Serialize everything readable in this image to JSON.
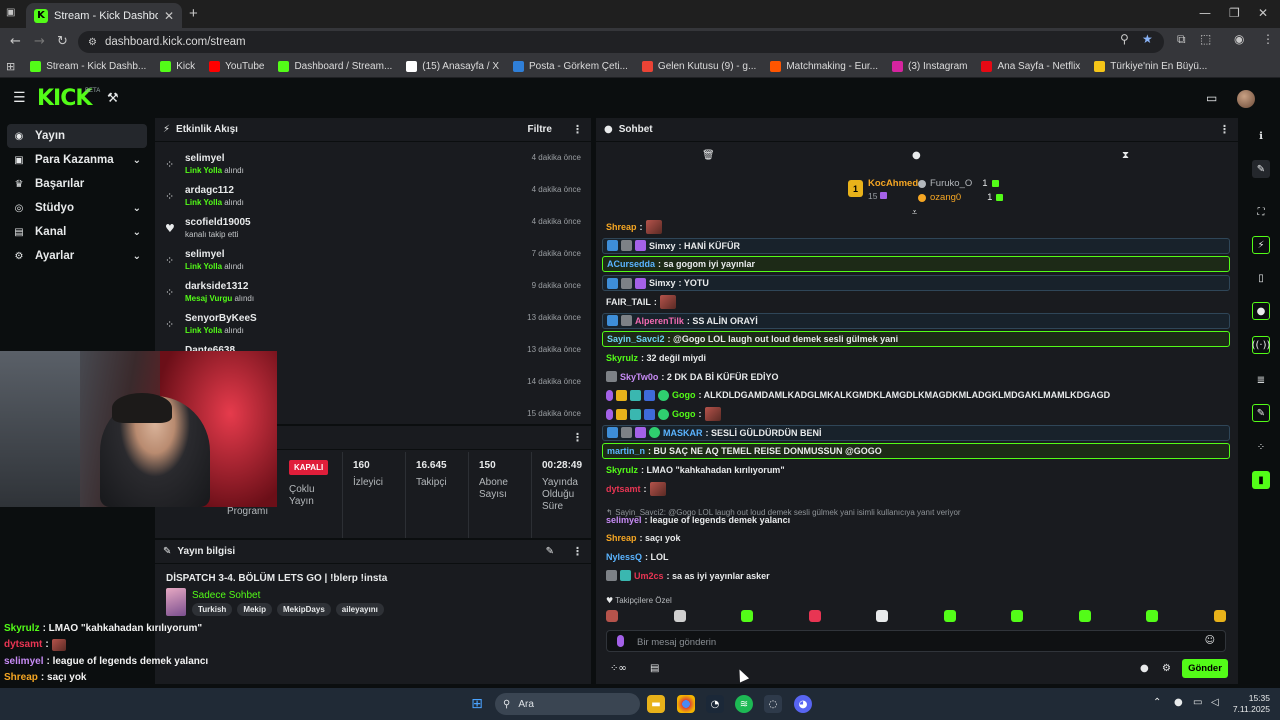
{
  "browser": {
    "tab_title": "Stream - Kick Dashboard",
    "url": "dashboard.kick.com/stream",
    "bookmarks": [
      {
        "label": "Stream - Kick Dashb...",
        "icon": "kick-icon",
        "color": "#53fc18"
      },
      {
        "label": "Kick",
        "icon": "kick-icon",
        "color": "#53fc18"
      },
      {
        "label": "YouTube",
        "icon": "youtube-icon",
        "color": "#ff0000"
      },
      {
        "label": "Dashboard / Stream...",
        "icon": "kick-icon",
        "color": "#53fc18"
      },
      {
        "label": "(15) Anasayfa / X",
        "icon": "x-icon",
        "color": "#ffffff"
      },
      {
        "label": "Posta - Görkem Çeti...",
        "icon": "outlook-icon",
        "color": "#2f7fd8"
      },
      {
        "label": "Gelen Kutusu (9) - g...",
        "icon": "gmail-icon",
        "color": "#ea4335"
      },
      {
        "label": "Matchmaking - Eur...",
        "icon": "faceit-icon",
        "color": "#ff5500"
      },
      {
        "label": "(3) Instagram",
        "icon": "instagram-icon",
        "color": "#d6249f"
      },
      {
        "label": "Ana Sayfa - Netflix",
        "icon": "netflix-icon",
        "color": "#e50914"
      },
      {
        "label": "Türkiye'nin En Büyü...",
        "icon": "eksi-icon",
        "color": "#f5c518"
      }
    ]
  },
  "kick": {
    "logo": "KICK",
    "beta": "BETA"
  },
  "sidebar": {
    "items": [
      {
        "label": "Yayın",
        "icon": "stream-icon",
        "active": true,
        "expandable": false
      },
      {
        "label": "Para Kazanma",
        "icon": "money-icon",
        "active": false,
        "expandable": true
      },
      {
        "label": "Başarılar",
        "icon": "trophy-icon",
        "active": false,
        "expandable": false
      },
      {
        "label": "Stüdyo",
        "icon": "studio-icon",
        "active": false,
        "expandable": true
      },
      {
        "label": "Kanal",
        "icon": "channel-icon",
        "active": false,
        "expandable": true
      },
      {
        "label": "Ayarlar",
        "icon": "gear-icon",
        "active": false,
        "expandable": true
      }
    ]
  },
  "activity": {
    "title": "Etkinlik Akışı",
    "filter": "Filtre",
    "items": [
      {
        "user": "selimyel",
        "highlight": "Link Yolla",
        "rest": " alındı",
        "time": "4 dakika önce",
        "icon": "reward-icon"
      },
      {
        "user": "ardagc112",
        "highlight": "Link Yolla",
        "rest": " alındı",
        "time": "4 dakika önce",
        "icon": "reward-icon"
      },
      {
        "user": "scofield19005",
        "highlight": "",
        "rest": "kanalı takip etti",
        "time": "4 dakika önce",
        "icon": "heart-icon"
      },
      {
        "user": "selimyel",
        "highlight": "Link Yolla",
        "rest": " alındı",
        "time": "7 dakika önce",
        "icon": "reward-icon"
      },
      {
        "user": "darkside1312",
        "highlight": "Mesaj Vurgu",
        "rest": " alındı",
        "time": "9 dakika önce",
        "icon": "reward-icon"
      },
      {
        "user": "SenyorByKeeS",
        "highlight": "Link Yolla",
        "rest": " alındı",
        "time": "13 dakika önce",
        "icon": "reward-icon"
      },
      {
        "user": "Dante6638",
        "highlight": "",
        "rest": "",
        "time": "13 dakika önce",
        "icon": "reward-icon"
      },
      {
        "user": "",
        "highlight": "",
        "rest": "",
        "time": "14 dakika önce",
        "icon": ""
      },
      {
        "user": "",
        "highlight": "",
        "rest": "",
        "time": "15 dakika önce",
        "icon": ""
      }
    ]
  },
  "stats": {
    "status": "KAPALI",
    "status_label_1": "Çoklu",
    "status_label_2": "Yayın",
    "program_label": "Programı",
    "viewers": {
      "value": "160",
      "label": "İzleyici"
    },
    "followers": {
      "value": "16.645",
      "label": "Takipçi"
    },
    "subs": {
      "value": "150",
      "label_1": "Abone",
      "label_2": "Sayısı"
    },
    "uptime": {
      "value": "00:28:49",
      "label_1": "Yayında",
      "label_2": "Olduğu",
      "label_3": "Süre"
    }
  },
  "stream_info": {
    "title": "Yayın bilgisi",
    "stream_title": "DİSPATCH 3-4. BÖLÜM LETS GO | !blerp !insta",
    "category": "Sadece Sohbet",
    "tags": [
      "Turkish",
      "Mekip",
      "MekipDays",
      "aileyayını"
    ]
  },
  "overlay_chat": [
    {
      "user": "Skyrulz",
      "color": "#53fc18",
      "text": ": LMAO \"kahkahadan kırılıyorum\"",
      "emote": false
    },
    {
      "user": "dytsamt",
      "color": "#e83553",
      "text": ":",
      "emote": true
    },
    {
      "user": "selimyel",
      "color": "#c78bf5",
      "text": ": league of legends demek yalancı",
      "emote": false
    },
    {
      "user": "Shreap",
      "color": "#f5a623",
      "text": ": saçı yok",
      "emote": false
    },
    {
      "user": "NylessQ",
      "color": "#5ab4ff",
      "text": ": LOL",
      "emote": false
    },
    {
      "user": "Um2cs",
      "color": "#e83553",
      "text": ": sa as iyi yayınlar asker",
      "emote": false
    }
  ],
  "chat": {
    "title": "Sohbet",
    "leaderboard": {
      "first": {
        "rank": "1",
        "name": "KocAhmed",
        "count": "15"
      },
      "others": [
        {
          "name": "Furuko_O",
          "count": "1",
          "color": "#b3b7bb"
        },
        {
          "name": "ozang0",
          "count": "1",
          "color": "#f5a623"
        }
      ]
    },
    "messages": [
      {
        "user": "Shreap",
        "color": "#f5a623",
        "text": ":",
        "badges": [],
        "emote": true,
        "style": ""
      },
      {
        "user": "Simxy",
        "color": "#e8eaeb",
        "text": ": HANİ KÜFÜR",
        "badges": [
          "b-blue",
          "b-gray",
          "b-purple"
        ],
        "emote": false,
        "style": "hl-blue"
      },
      {
        "user": "ACursedda",
        "color": "#5ab4ff",
        "text": ": sa gogom iyi yayınlar",
        "badges": [],
        "emote": false,
        "style": "hl"
      },
      {
        "user": "Simxy",
        "color": "#e8eaeb",
        "text": ": YOTU",
        "badges": [
          "b-blue",
          "b-gray",
          "b-purple"
        ],
        "emote": false,
        "style": "hl-blue"
      },
      {
        "user": "FAIR_TAIL",
        "color": "#e8eaeb",
        "text": ":",
        "badges": [],
        "emote": true,
        "style": ""
      },
      {
        "user": "AlperenTilk",
        "color": "#f06ab0",
        "text": ": SS ALİN ORAYİ",
        "badges": [
          "b-blue",
          "b-gray"
        ],
        "emote": false,
        "style": "hl-blue"
      },
      {
        "user": "Sayin_Savci2",
        "color": "#6fd3f5",
        "text": ": @Gogo LOL laugh out loud demek sesli gülmek yani",
        "badges": [],
        "emote": false,
        "style": "hl"
      },
      {
        "user": "Skyrulz",
        "color": "#53fc18",
        "text": ": 32 değil miydi",
        "badges": [],
        "emote": false,
        "style": ""
      },
      {
        "user": "SkyTw0o",
        "color": "#c78bf5",
        "text": ": 2 DK DA Bİ KÜFÜR EDİYO",
        "badges": [
          "b-gray"
        ],
        "emote": false,
        "style": ""
      },
      {
        "user": "Gogo",
        "color": "#53fc18",
        "text": ": ALKDLDGAMDAMLKADGLMKALKGMDKLAMGDLKMAGDKMLADGKLMDGAKLMAMLKDGAGD",
        "badges": [
          "b-mic",
          "b-gold",
          "b-teal",
          "b-blue2",
          "b-green"
        ],
        "emote": false,
        "style": ""
      },
      {
        "user": "Gogo",
        "color": "#53fc18",
        "text": ":",
        "badges": [
          "b-mic",
          "b-gold",
          "b-teal",
          "b-blue2",
          "b-green"
        ],
        "emote": true,
        "style": ""
      },
      {
        "user": "MASKAR",
        "color": "#5ab4ff",
        "text": ": SESLİ GÜLDÜRDÜN BENİ",
        "badges": [
          "b-blue",
          "b-gray",
          "b-purple",
          "b-green"
        ],
        "emote": false,
        "style": "hl-blue"
      },
      {
        "user": "martin_n",
        "color": "#5ab4ff",
        "text": ": BU SAÇ NE AQ TEMEL REISE DONMUSSUN @GOGO",
        "badges": [],
        "emote": false,
        "style": "hl"
      },
      {
        "user": "Skyrulz",
        "color": "#53fc18",
        "text": ": LMAO \"kahkahadan kırılıyorum\"",
        "badges": [],
        "emote": false,
        "style": ""
      },
      {
        "user": "dytsamt",
        "color": "#e83553",
        "text": ":",
        "badges": [],
        "emote": true,
        "style": ""
      },
      {
        "user": "selimyel",
        "color": "#c78bf5",
        "text": ": league of legends demek yalancı",
        "badges": [],
        "emote": false,
        "style": ""
      },
      {
        "user": "Shreap",
        "color": "#f5a623",
        "text": ": saçı yok",
        "badges": [],
        "emote": false,
        "style": ""
      },
      {
        "user": "NylessQ",
        "color": "#5ab4ff",
        "text": ": LOL",
        "badges": [],
        "emote": false,
        "style": ""
      },
      {
        "user": "Um2cs",
        "color": "#e83553",
        "text": ": sa as iyi yayınlar asker",
        "badges": [
          "b-gray",
          "b-teal"
        ],
        "emote": false,
        "style": ""
      }
    ],
    "reply_context": "Sayin_Savci2: @Gogo LOL laugh out loud demek sesli gülmek yani isimli kullanıcıya yanıt veriyor",
    "followers_only": "Takipçilere Özel",
    "input_placeholder": "Bir mesaj gönderin",
    "send_label": "Gönder"
  },
  "taskbar": {
    "search": "Ara",
    "time": "15:35",
    "date": "7.11.2025"
  }
}
